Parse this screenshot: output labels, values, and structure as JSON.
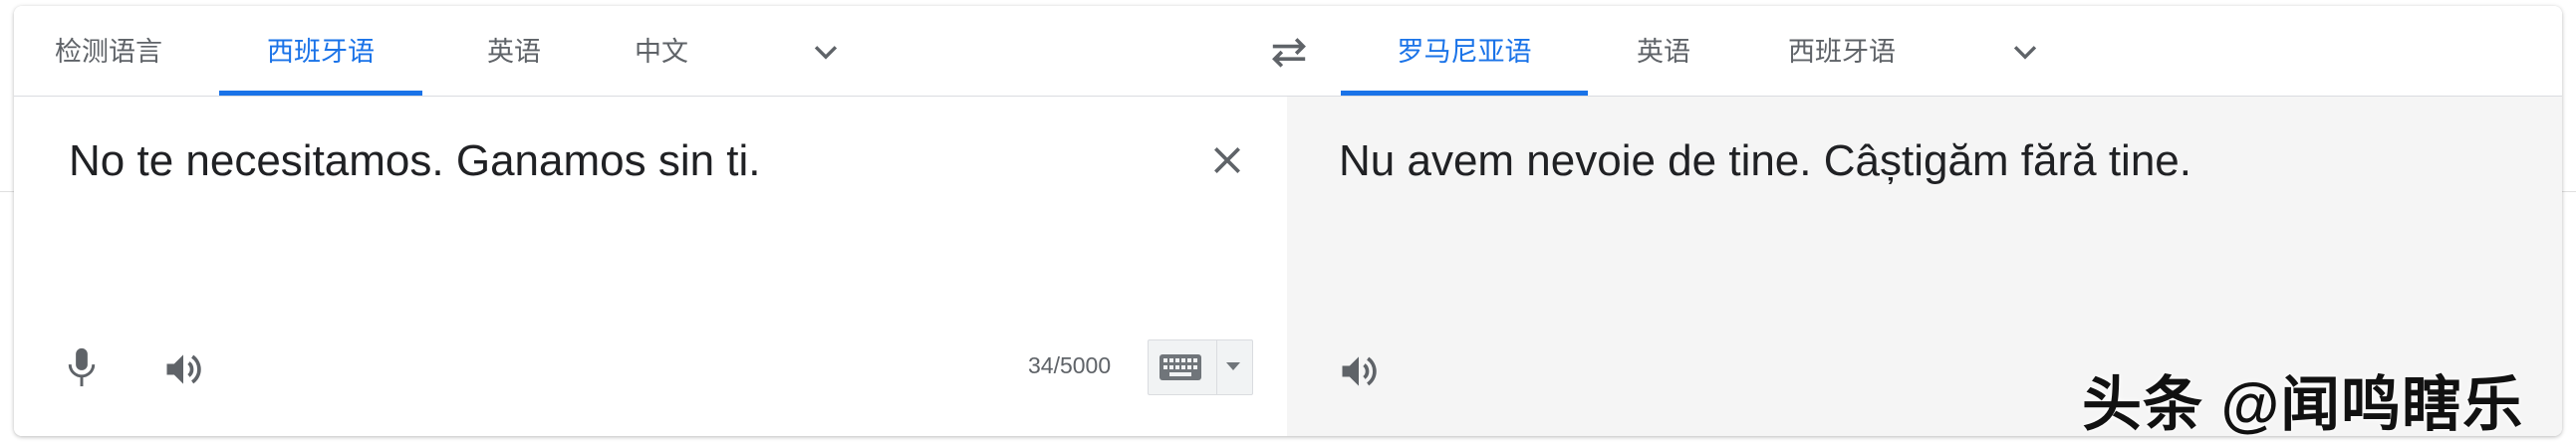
{
  "source_tabs": [
    "检测语言",
    "西班牙语",
    "英语",
    "中文"
  ],
  "target_tabs": [
    "罗马尼亚语",
    "英语",
    "西班牙语"
  ],
  "source": {
    "text": "No te necesitamos. Ganamos sin ti.",
    "char_count": "34/5000"
  },
  "target": {
    "text": "Nu avem nevoie de tine. Câștigăm fără tine."
  },
  "watermark": "头条 @闻鸣瞎乐",
  "colors": {
    "accent": "#1a73e8",
    "text": "#202124",
    "muted": "#5f6368",
    "target_bg": "#f5f5f5"
  },
  "icons": [
    "chevron-down-icon",
    "swap-languages-icon",
    "close-icon",
    "microphone-icon",
    "speaker-icon",
    "keyboard-icon"
  ]
}
